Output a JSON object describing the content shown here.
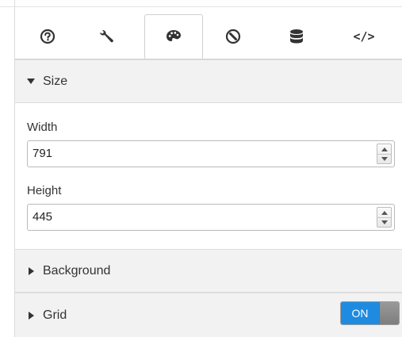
{
  "tabs": [
    {
      "name": "general",
      "icon": "info-icon",
      "active": false
    },
    {
      "name": "tools",
      "icon": "wrench-icon",
      "active": false
    },
    {
      "name": "appearance",
      "icon": "palette-icon",
      "active": true
    },
    {
      "name": "navigation",
      "icon": "compass-icon",
      "active": false
    },
    {
      "name": "data",
      "icon": "database-icon",
      "active": false
    },
    {
      "name": "embed",
      "icon": "code-icon",
      "label": "</>",
      "active": false
    }
  ],
  "size_section": {
    "title": "Size",
    "expanded": true,
    "width_label": "Width",
    "width_value": "791",
    "height_label": "Height",
    "height_value": "445"
  },
  "background_section": {
    "title": "Background",
    "expanded": false
  },
  "grid_section": {
    "title": "Grid",
    "expanded": false,
    "toggle_label": "ON",
    "toggle_on": true
  },
  "colors": {
    "toggle_on": "#1e8be0",
    "header_bg": "#f2f2f2"
  }
}
